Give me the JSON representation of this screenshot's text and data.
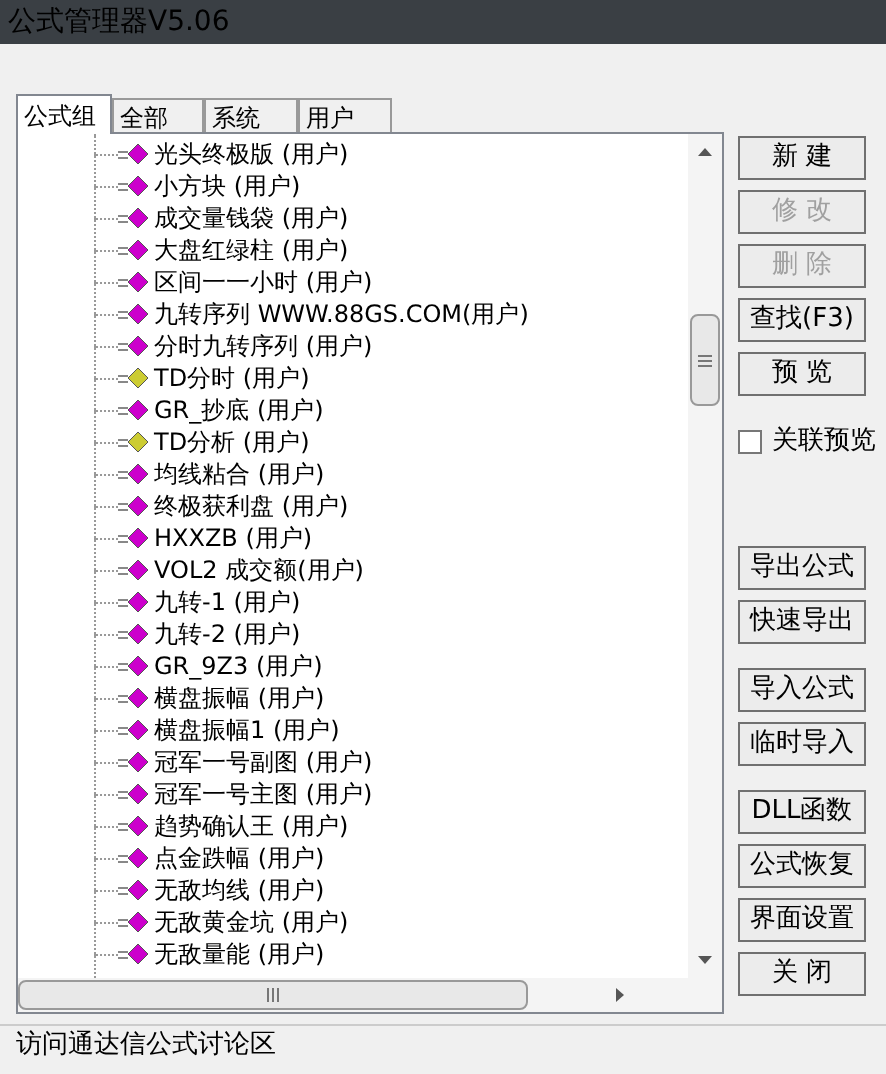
{
  "window": {
    "title": "公式管理器V5.06"
  },
  "tabs": [
    {
      "label": "公式组",
      "selected": true
    },
    {
      "label": "全部",
      "selected": false
    },
    {
      "label": "系统",
      "selected": false
    },
    {
      "label": "用户",
      "selected": false
    }
  ],
  "tree": {
    "items": [
      {
        "label": "光头终极版 (用户)",
        "color": "#cc00cc"
      },
      {
        "label": "小方块 (用户)",
        "color": "#cc00cc"
      },
      {
        "label": "成交量钱袋 (用户)",
        "color": "#cc00cc"
      },
      {
        "label": "大盘红绿柱 (用户)",
        "color": "#cc00cc"
      },
      {
        "label": "区间一一小时 (用户)",
        "color": "#cc00cc"
      },
      {
        "label": "九转序列 WWW.88GS.COM(用户)",
        "color": "#cc00cc"
      },
      {
        "label": "分时九转序列 (用户)",
        "color": "#cc00cc"
      },
      {
        "label": "TD分时 (用户)",
        "color": "#cccc33"
      },
      {
        "label": "GR_抄底 (用户)",
        "color": "#cc00cc"
      },
      {
        "label": "TD分析 (用户)",
        "color": "#cccc33"
      },
      {
        "label": "均线粘合 (用户)",
        "color": "#cc00cc"
      },
      {
        "label": "终极获利盘 (用户)",
        "color": "#cc00cc"
      },
      {
        "label": "HXXZB (用户)",
        "color": "#cc00cc"
      },
      {
        "label": "VOL2 成交额(用户)",
        "color": "#cc00cc"
      },
      {
        "label": "九转-1 (用户)",
        "color": "#cc00cc"
      },
      {
        "label": "九转-2 (用户)",
        "color": "#cc00cc"
      },
      {
        "label": "GR_9Z3 (用户)",
        "color": "#cc00cc"
      },
      {
        "label": "横盘振幅 (用户)",
        "color": "#cc00cc"
      },
      {
        "label": "横盘振幅1 (用户)",
        "color": "#cc00cc"
      },
      {
        "label": "冠军一号副图 (用户)",
        "color": "#cc00cc"
      },
      {
        "label": "冠军一号主图 (用户)",
        "color": "#cc00cc"
      },
      {
        "label": "趋势确认王 (用户)",
        "color": "#cc00cc"
      },
      {
        "label": "点金跌幅 (用户)",
        "color": "#cc00cc"
      },
      {
        "label": "无敌均线 (用户)",
        "color": "#cc00cc"
      },
      {
        "label": "无敌黄金坑 (用户)",
        "color": "#cc00cc"
      },
      {
        "label": "无敌量能 (用户)",
        "color": "#cc00cc"
      }
    ]
  },
  "side": [
    {
      "items": [
        {
          "kind": "button",
          "label": "新 建",
          "disabled": false
        },
        {
          "kind": "button",
          "label": "修 改",
          "disabled": true
        },
        {
          "kind": "button",
          "label": "删 除",
          "disabled": true
        },
        {
          "kind": "button",
          "label": "查找(F3)",
          "disabled": false
        },
        {
          "kind": "button",
          "label": "预 览",
          "disabled": false
        },
        {
          "kind": "checkbox",
          "label": "关联预览",
          "checked": false
        }
      ]
    },
    {
      "items": [
        {
          "kind": "button",
          "label": "导出公式",
          "disabled": false
        },
        {
          "kind": "button",
          "label": "快速导出",
          "disabled": false
        }
      ]
    },
    {
      "items": [
        {
          "kind": "button",
          "label": "导入公式",
          "disabled": false
        },
        {
          "kind": "button",
          "label": "临时导入",
          "disabled": false
        }
      ]
    },
    {
      "items": [
        {
          "kind": "button",
          "label": "DLL函数",
          "disabled": false
        },
        {
          "kind": "button",
          "label": "公式恢复",
          "disabled": false
        },
        {
          "kind": "button",
          "label": "界面设置",
          "disabled": false
        },
        {
          "kind": "button",
          "label": "关 闭",
          "disabled": false
        }
      ]
    }
  ],
  "status_bar": {
    "text": "访问通达信公式讨论区"
  }
}
